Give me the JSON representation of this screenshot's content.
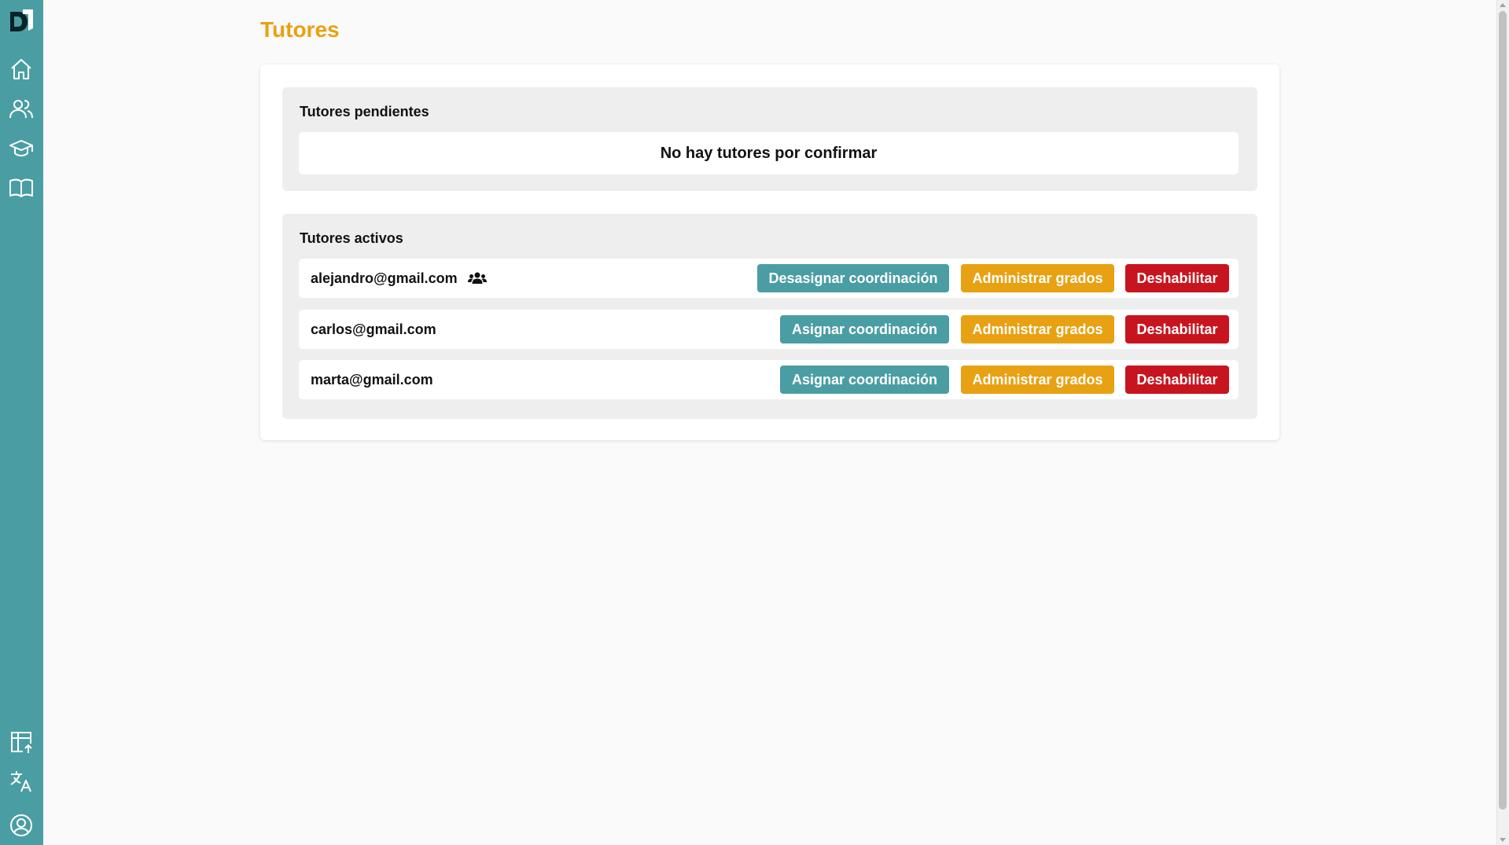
{
  "colors": {
    "sidebar": "#4a9ea3",
    "accent": "#e8a112",
    "danger": "#c8141e",
    "teal_button": "#4a9ea3"
  },
  "sidebar": {
    "top_items": [
      {
        "icon": "home-icon"
      },
      {
        "icon": "users-icon"
      },
      {
        "icon": "graduation-cap-icon"
      },
      {
        "icon": "book-icon"
      }
    ],
    "bottom_items": [
      {
        "icon": "table-upload-icon"
      },
      {
        "icon": "translate-icon"
      },
      {
        "icon": "user-circle-icon"
      }
    ]
  },
  "page": {
    "title": "Tutores"
  },
  "pending": {
    "title": "Tutores pendientes",
    "empty_message": "No hay tutores por confirmar"
  },
  "active": {
    "title": "Tutores activos",
    "tutors": [
      {
        "email": "alejandro@gmail.com",
        "is_coordinator": true,
        "coord_button": "Desasignar coordinación",
        "grades_button": "Administrar grados",
        "disable_button": "Deshabilitar"
      },
      {
        "email": "carlos@gmail.com",
        "is_coordinator": false,
        "coord_button": "Asignar coordinación",
        "grades_button": "Administrar grados",
        "disable_button": "Deshabilitar"
      },
      {
        "email": "marta@gmail.com",
        "is_coordinator": false,
        "coord_button": "Asignar coordinación",
        "grades_button": "Administrar grados",
        "disable_button": "Deshabilitar"
      }
    ]
  }
}
